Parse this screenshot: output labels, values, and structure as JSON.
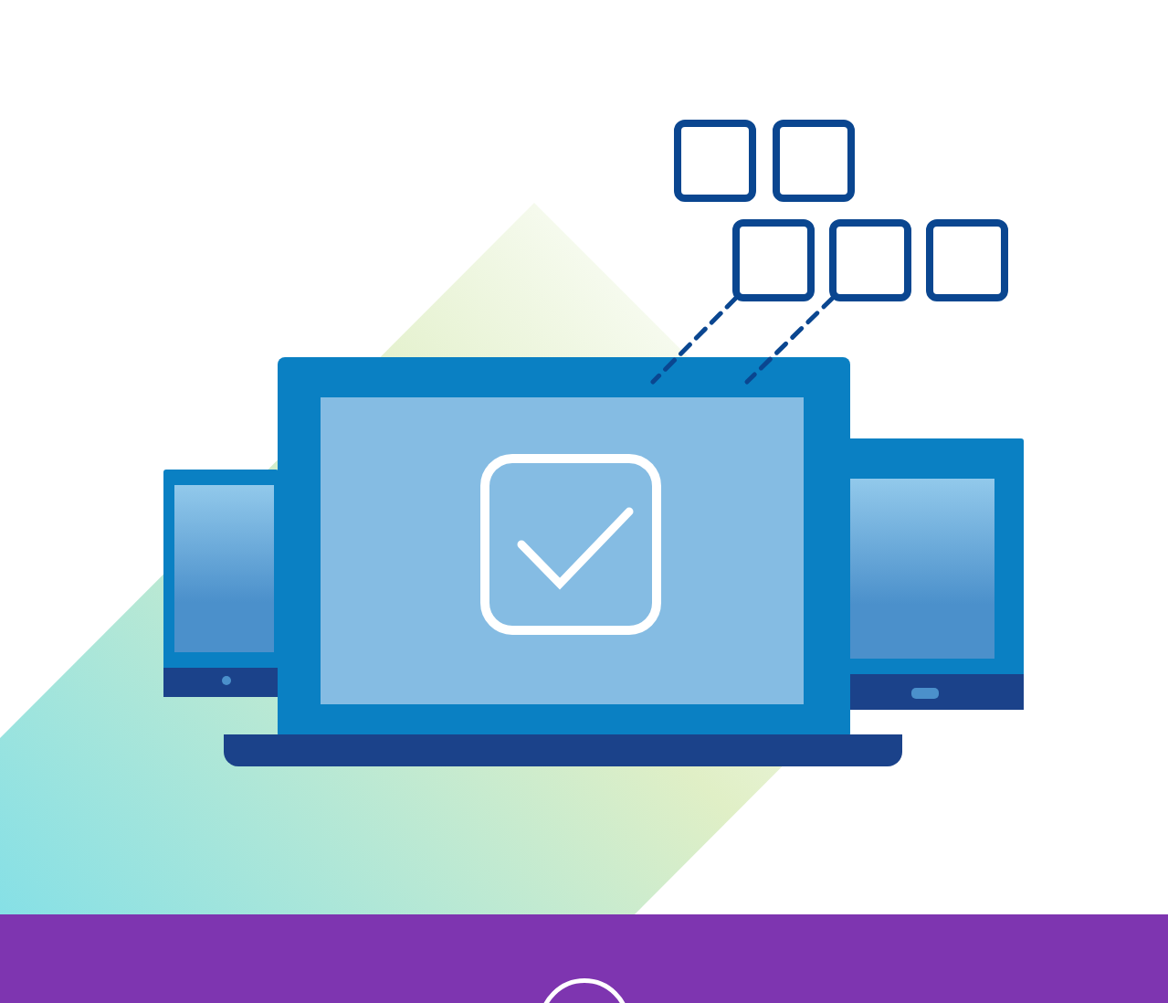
{
  "sections": [
    {
      "kind": "illustration"
    },
    {
      "kind": "footer_band"
    }
  ]
}
